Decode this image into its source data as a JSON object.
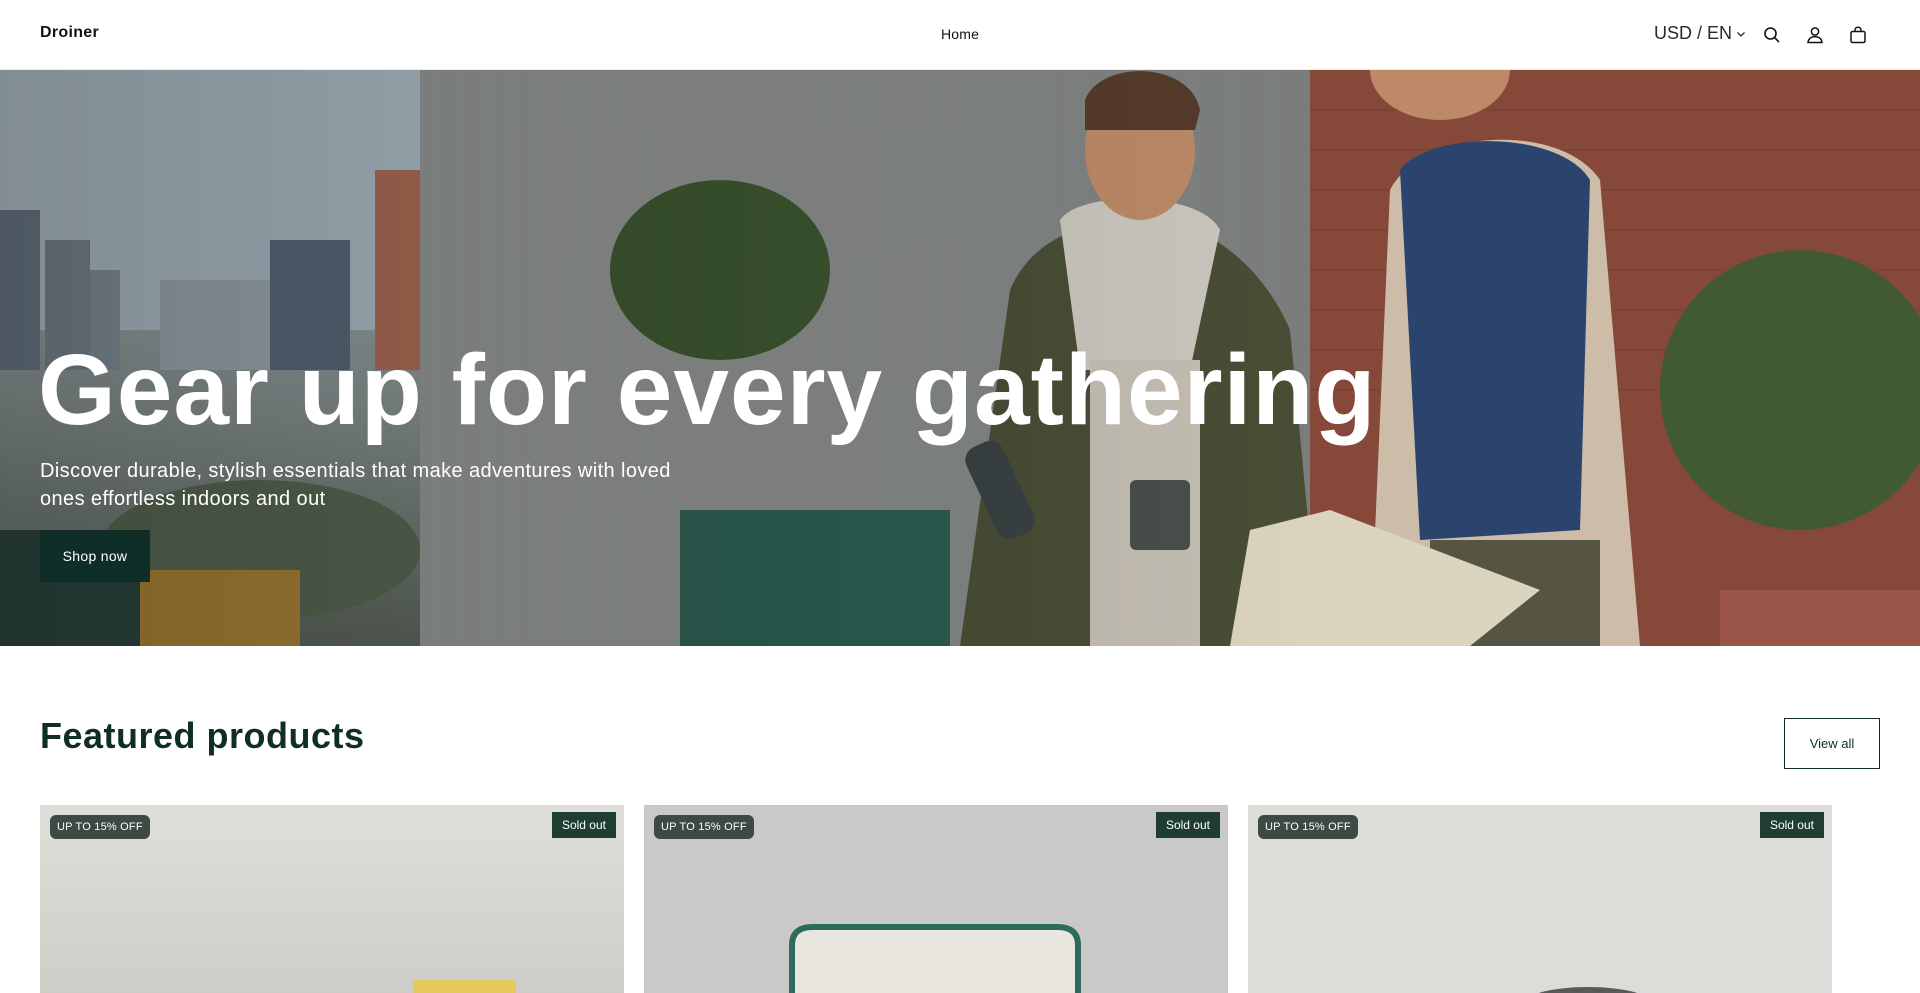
{
  "header": {
    "logo": "Droiner",
    "nav": {
      "home": "Home"
    },
    "locale": "USD / EN",
    "icons": [
      "search-icon",
      "account-icon",
      "cart-icon"
    ]
  },
  "hero": {
    "title": "Gear up for every gathering",
    "subtitle": "Discover durable, stylish essentials that make adventures with loved ones effortless indoors and out",
    "cta": "Shop now"
  },
  "featured": {
    "title": "Featured products",
    "view_all": "View all",
    "products": [
      {
        "discount_badge": "UP TO 15% OFF",
        "status_badge": "Sold out"
      },
      {
        "discount_badge": "UP TO 15% OFF",
        "status_badge": "Sold out"
      },
      {
        "discount_badge": "UP TO 15% OFF",
        "status_badge": "Sold out"
      }
    ]
  },
  "colors": {
    "brand_dark": "#0f2e27",
    "sold_badge": "#1f3d33",
    "discount_badge": "#3d4a44"
  }
}
